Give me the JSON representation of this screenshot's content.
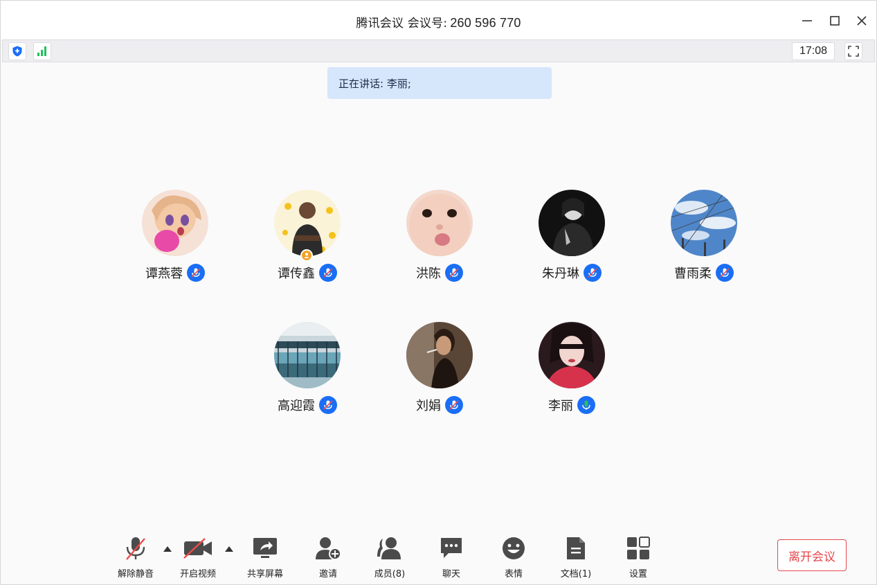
{
  "window": {
    "title": "腾讯会议 会议号:",
    "meeting_id": "260 596 770"
  },
  "statusbar": {
    "clock": "17:08"
  },
  "speaking": {
    "text": "正在讲话: 李丽;"
  },
  "participants": [
    {
      "name": "谭燕蓉",
      "mic": "muted"
    },
    {
      "name": "谭传鑫",
      "mic": "muted",
      "host": true
    },
    {
      "name": "洪陈",
      "mic": "muted"
    },
    {
      "name": "朱丹琳",
      "mic": "muted"
    },
    {
      "name": "曹雨柔",
      "mic": "muted"
    },
    {
      "name": "高迎霞",
      "mic": "muted"
    },
    {
      "name": "刘娟",
      "mic": "muted"
    },
    {
      "name": "李丽",
      "mic": "speaking"
    }
  ],
  "toolbar": {
    "unmute": "解除静音",
    "start_video": "开启视频",
    "share_screen": "共享屏幕",
    "invite": "邀请",
    "members": "成员(8)",
    "chat": "聊天",
    "reactions": "表情",
    "docs": "文档(1)",
    "settings": "设置",
    "leave": "离开会议"
  },
  "icons": {
    "min": "minimize-icon",
    "max": "maximize-icon",
    "close": "close-icon",
    "shield": "shield-icon",
    "signal": "signal-icon",
    "fullscreen": "fullscreen-icon"
  },
  "colors": {
    "accent_blue": "#1a6ef5",
    "speaking_green": "#2fbd5a",
    "leave_red": "#e6474b",
    "banner_bg": "#d6e6fb",
    "muted_red": "#ef4b4b"
  }
}
